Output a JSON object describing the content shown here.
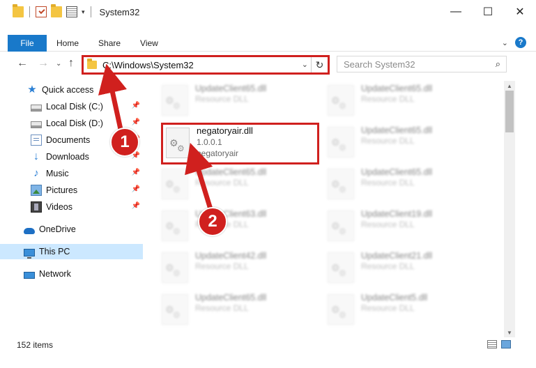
{
  "window": {
    "title": "System32",
    "buttons": {
      "minimize": "—",
      "maximize": "☐",
      "close": "✕"
    }
  },
  "ribbon": {
    "file": "File",
    "tabs": [
      "Home",
      "Share",
      "View"
    ]
  },
  "address": {
    "path": "C:\\Windows\\System32"
  },
  "search": {
    "placeholder": "Search System32"
  },
  "sidebar": {
    "items": [
      {
        "label": "Quick access",
        "icon": "star-icon"
      },
      {
        "label": "Local Disk (C:)",
        "icon": "disk-icon",
        "pinned": true
      },
      {
        "label": "Local Disk (D:)",
        "icon": "disk-icon",
        "pinned": true
      },
      {
        "label": "Documents",
        "icon": "documents-icon",
        "pinned": true
      },
      {
        "label": "Downloads",
        "icon": "download-icon",
        "pinned": true
      },
      {
        "label": "Music",
        "icon": "music-icon",
        "pinned": true
      },
      {
        "label": "Pictures",
        "icon": "pictures-icon",
        "pinned": true
      },
      {
        "label": "Videos",
        "icon": "videos-icon",
        "pinned": true
      },
      {
        "label": "OneDrive",
        "icon": "onedrive-icon"
      },
      {
        "label": "This PC",
        "icon": "pc-icon",
        "selected": true
      },
      {
        "label": "Network",
        "icon": "network-icon"
      }
    ]
  },
  "files": {
    "left": [
      {
        "name": "UpdateClient65.dll",
        "desc": "Resource DLL"
      },
      {
        "name": "UpdateClient65.dll",
        "desc": "Resource DLL"
      },
      {
        "name": "UpdateClient63.dll",
        "desc": "Resource DLL"
      },
      {
        "name": "UpdateClient42.dll",
        "desc": "Resource DLL"
      },
      {
        "name": "UpdateClient65.dll",
        "desc": "Resource DLL"
      }
    ],
    "right": [
      {
        "name": "UpdateClient65.dll",
        "desc": "Resource DLL"
      },
      {
        "name": "UpdateClient65.dll",
        "desc": "Resource DLL"
      },
      {
        "name": "UpdateClient65.dll",
        "desc": "Resource DLL"
      },
      {
        "name": "UpdateClient19.dll",
        "desc": "Resource DLL"
      },
      {
        "name": "UpdateClient21.dll",
        "desc": "Resource DLL"
      },
      {
        "name": "UpdateClient5.dll",
        "desc": "Resource DLL"
      }
    ],
    "highlighted": {
      "name": "negatoryair.dll",
      "version": "1.0.0.1",
      "company": "negatoryair"
    }
  },
  "status": {
    "count": "152 items"
  },
  "annotations": {
    "step1": "1",
    "step2": "2",
    "color": "#d0201e"
  }
}
